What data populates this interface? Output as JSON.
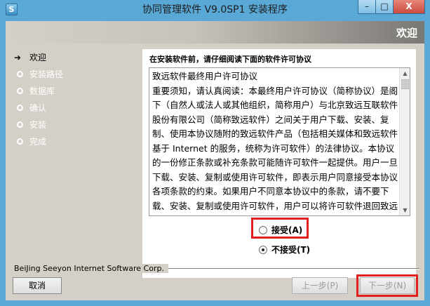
{
  "window": {
    "title": "协同管理软件 V9.0SP1 安装程序",
    "app_icon": "S",
    "minimize": "–",
    "maximize": "□",
    "close": "X"
  },
  "header": {
    "title": "欢迎"
  },
  "steps": [
    {
      "label": "欢迎",
      "active": true
    },
    {
      "label": "安装路径",
      "active": false
    },
    {
      "label": "数据库",
      "active": false
    },
    {
      "label": "确认",
      "active": false
    },
    {
      "label": "安装",
      "active": false
    },
    {
      "label": "完成",
      "active": false
    }
  ],
  "license": {
    "heading": "在安装软件前，请仔细阅读下面的软件许可协议",
    "text": "致远软件最终用户许可协议\n重要须知，请认真阅读：本最终用户许可协议（简称协议）是阁下（自然人或法人或其他组织，简称用户）与北京致远互联软件股份有限公司（简称致远软件）之间关于用户下载、安装、复制、使用本协议随附的致远软件产品（包括相关媒体和致远软件基于 Internet 的服务，统称为许可软件）的法律协议。本协议的一份修正条款或补充条款可能随许可软件一起提供。用户一旦下载、安装、复制或使用许可软件，即表示用户同意接受本协议各项条款的约束。如果用户不同意本协议中的条款，请不要下载、安装、复制或使用许可软件，用户可以将许可软件退回致远软件。"
  },
  "agreement": {
    "accept_label": "接受(A)",
    "decline_label": "不接受(T)",
    "selected": "decline"
  },
  "footer": {
    "company": "BeiJing Seeyon Internet Software Corp.",
    "cancel_label": "取消",
    "prev_label": "上一步(P)",
    "next_label": "下一步(N)"
  },
  "icons": {
    "active_step": "arrow-right-icon",
    "pending_step": "circle-icon"
  },
  "colors": {
    "titlebar": "#5aa8d6",
    "dialog_bg": "#d4d0c8",
    "highlight": "#e11f1f"
  }
}
